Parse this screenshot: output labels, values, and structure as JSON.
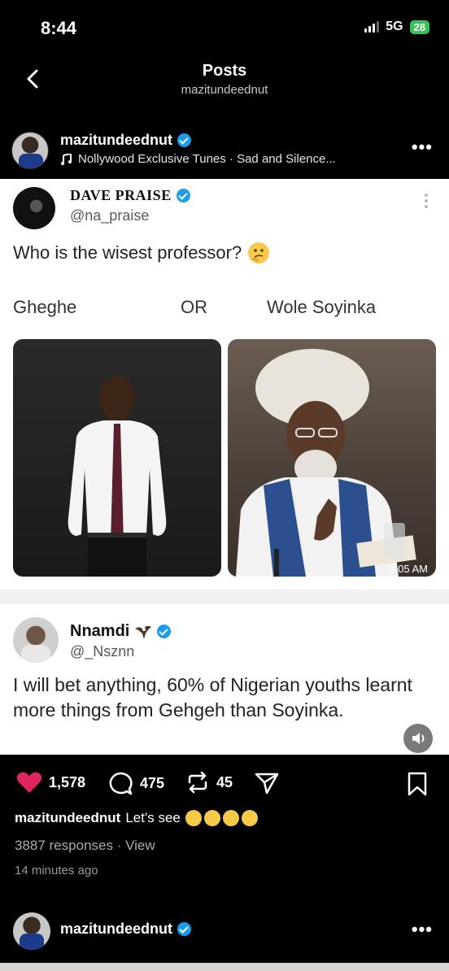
{
  "status_bar": {
    "time": "8:44",
    "network": "5G",
    "battery": "28"
  },
  "nav": {
    "title": "Posts",
    "subtitle": "mazitundeednut"
  },
  "post": {
    "author": "mazitundeednut",
    "music": "Nollywood Exclusive Tunes · Sad and Silence..."
  },
  "tweet1": {
    "name": "DAVE PRAISE",
    "handle": "@na_praise",
    "text": "Who is the wisest professor?",
    "option_left": "Gheghe",
    "or_label": "OR",
    "option_right": "Wole Soyinka",
    "timestamp": "8:05 AM"
  },
  "tweet2": {
    "name": "Nnamdi",
    "handle": "@_Nsznn",
    "text": "I will bet anything, 60% of Nigerian youths learnt more things from Gehgeh than Soyinka."
  },
  "actions": {
    "likes": "1,578",
    "comments": "475",
    "reposts": "45"
  },
  "caption": {
    "author": "mazitundeednut",
    "text": "Let's see"
  },
  "responses": "3887 responses · View",
  "time_ago": "14 minutes ago",
  "next_post": {
    "author": "mazitundeednut"
  },
  "colors": {
    "like": "#e0245e",
    "verified": "#1d9bf0",
    "battery": "#39c25a"
  }
}
